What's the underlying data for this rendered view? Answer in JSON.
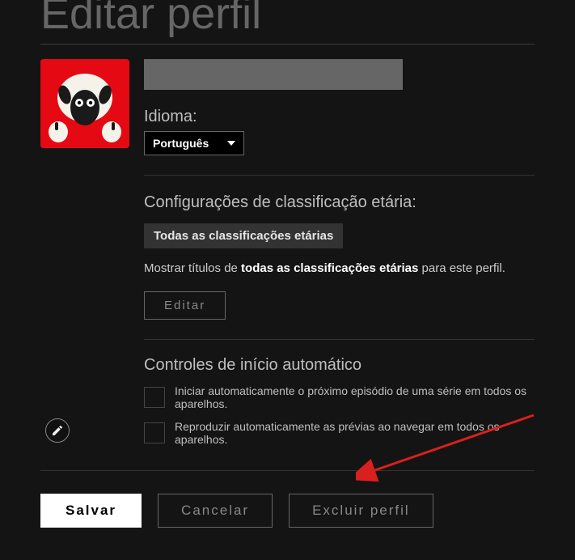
{
  "header": {
    "title": "Editar perfil"
  },
  "profile": {
    "name_value": "",
    "avatar_color": "#e50914"
  },
  "language": {
    "label": "Idioma:",
    "selected": "Português"
  },
  "maturity": {
    "heading": "Configurações de classificação etária:",
    "badge": "Todas as classificações etárias",
    "text_prefix": "Mostrar títulos de ",
    "text_bold": "todas as classificações etárias",
    "text_suffix": " para este perfil.",
    "edit_label": "Editar"
  },
  "autoplay": {
    "heading": "Controles de início automático",
    "opt1": "Iniciar automaticamente o próximo episódio de uma série em todos os aparelhos.",
    "opt2": "Reproduzir automaticamente as prévias ao navegar em todos os aparelhos."
  },
  "footer": {
    "save": "Salvar",
    "cancel": "Cancelar",
    "delete": "Excluir perfil"
  },
  "annotation": {
    "arrow_color": "#d9201e"
  }
}
